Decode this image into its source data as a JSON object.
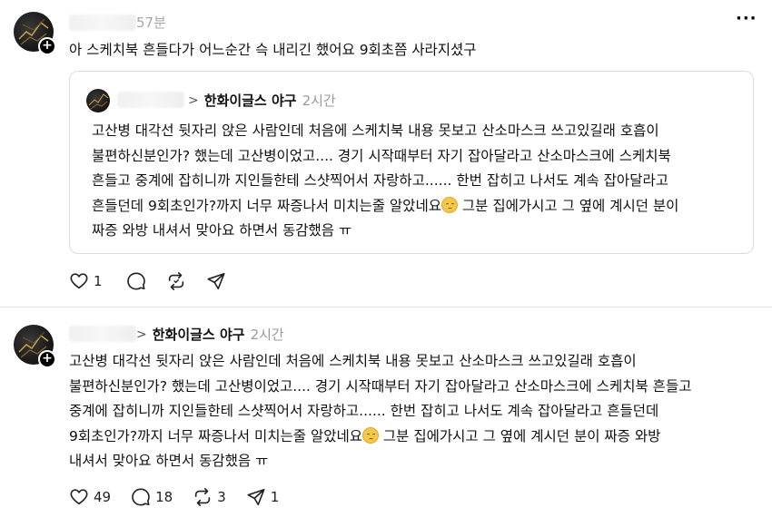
{
  "post1": {
    "time": "57분",
    "more_icon": "more-horizontal-icon",
    "text": "아 스케치북 흔들다가 어느순간 슥 내리긴 했어요 9회초쯤 사라지셨구",
    "quote": {
      "author": "한화이글스 야구",
      "ago": "2시간",
      "lines": [
        "고산병 대각선 뒷자리 앉은 사람인데 처음에 스케치북 내용 못보고 산소마스크 쓰고있길래 호흡이",
        "불편하신분인가? 했는데 고산병이었고.... 경기 시작때부터 자기 잡아달라고 산소마스크에 스케치북",
        "흔들고 중계에 잡히니까 지인들한테 스샷찍어서 자랑하고...... 한번 잡히고 나서도 계속 잡아달라고",
        "흔들던데 9회초인가?까지 너무 짜증나서 미치는줄 알았네요",
        " 그분 집에가시고 그 옆에 계시던 분이",
        "짜증 와방 내셔서 맞아요 하면서 동감했음 ㅠ"
      ]
    },
    "actions": {
      "like_count": "1",
      "like_icon": "heart-icon",
      "comment_icon": "comment-icon",
      "repost_icon": "repost-icon",
      "share_icon": "send-icon"
    }
  },
  "post2": {
    "author": "한화이글스 야구",
    "ago": "2시간",
    "lines": [
      "고산병 대각선 뒷자리 앉은 사람인데 처음에 스케치북 내용 못보고 산소마스크 쓰고있길래 호흡이",
      "불편하신분인가? 했는데 고산병이었고.... 경기 시작때부터 자기 잡아달라고 산소마스크에 스케치북 흔들고",
      "중계에 잡히니까 지인들한테 스샷찍어서 자랑하고...... 한번 잡히고 나서도 계속 잡아달라고 흔들던데",
      "9회초인가?까지 너무 짜증나서 미치는줄 알았네요",
      " 그분 집에가시고 그 옆에 계시던 분이 짜증 와방",
      "내셔서 맞아요 하면서 동감했음 ㅠ"
    ],
    "actions": {
      "like_count": "49",
      "comment_count": "18",
      "repost_count": "3",
      "share_count": "1"
    }
  }
}
